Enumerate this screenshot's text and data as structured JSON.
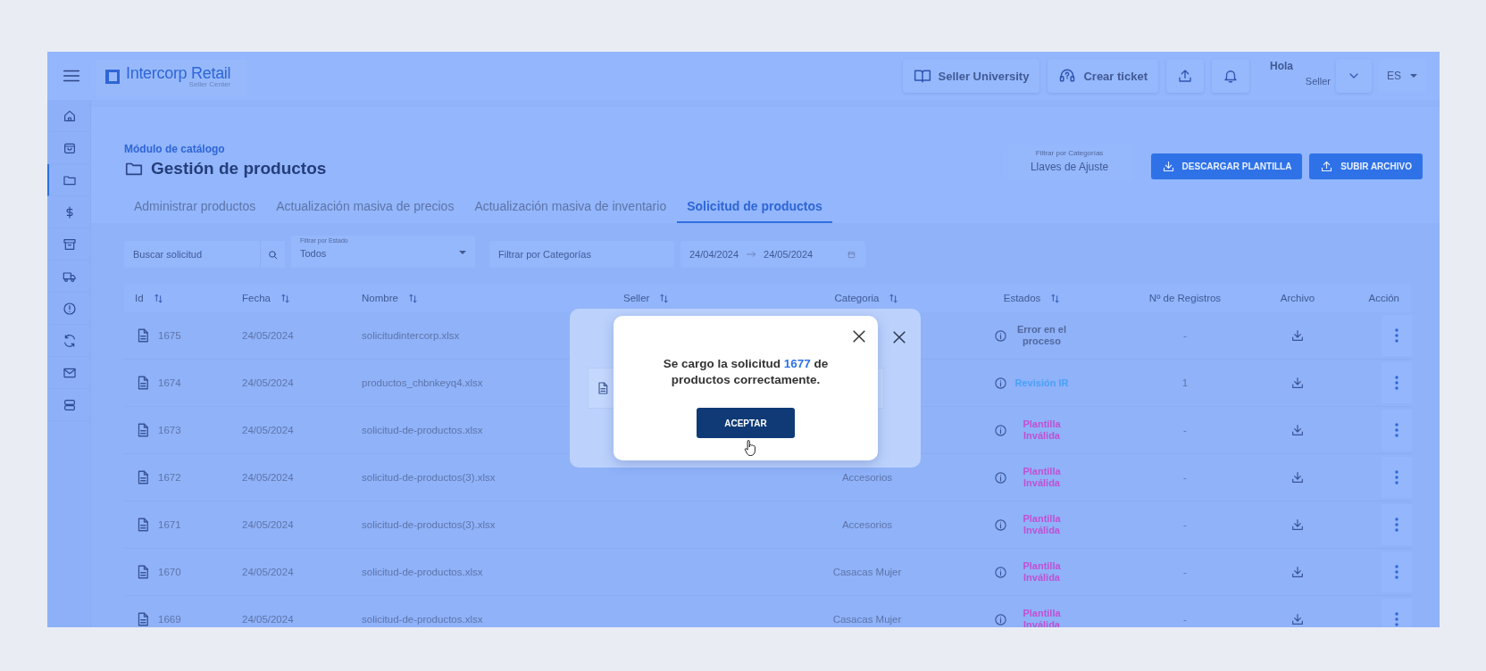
{
  "header": {
    "brand": "Intercorp Retail",
    "brand_subtitle": "Seller Center",
    "actions": [
      {
        "label": "Seller University",
        "kind": "book"
      },
      {
        "label": "Crear ticket",
        "kind": "support"
      }
    ],
    "greeting": "Hola",
    "user": "Seller",
    "language": "ES"
  },
  "sidebar": {
    "items": [
      {
        "selected": false
      },
      {
        "selected": false
      },
      {
        "selected": true
      },
      {
        "selected": false
      },
      {
        "selected": false
      },
      {
        "selected": false
      },
      {
        "selected": false
      },
      {
        "selected": false
      },
      {
        "selected": false
      },
      {
        "selected": false
      }
    ]
  },
  "page": {
    "breadcrumb": "Módulo de catálogo",
    "title": "Gestión de productos",
    "category_filter": {
      "label": "Filtrar por Categorías",
      "value": "Llaves de Ajuste"
    },
    "buttons": [
      {
        "label": "DESCARGAR PLANTILLA",
        "kind": "download"
      },
      {
        "label": "SUBIR ARCHIVO",
        "kind": "upload"
      }
    ]
  },
  "tabs": [
    {
      "label": "Administrar productos",
      "selected": false
    },
    {
      "label": "Actualización masiva de precios",
      "selected": false
    },
    {
      "label": "Actualización masiva de inventario",
      "selected": false
    },
    {
      "label": "Solicitud de productos",
      "selected": true
    }
  ],
  "filters": {
    "search": {
      "placeholder": "Buscar solicitud"
    },
    "state": {
      "label": "Filtrar por Estado",
      "value": "Todos"
    },
    "category": {
      "placeholder": "Filtrar por Categorías"
    },
    "date_from": "24/04/2024",
    "date_to": "24/05/2024"
  },
  "table": {
    "columns": [
      {
        "label": "Id",
        "sortable": true
      },
      {
        "label": "Fecha",
        "sortable": true
      },
      {
        "label": "Nombre",
        "sortable": true
      },
      {
        "label": "Seller",
        "sortable": true
      },
      {
        "label": "Categoria",
        "sortable": true
      },
      {
        "label": "Estados",
        "sortable": true
      },
      {
        "label": "Nº de Registros",
        "sortable": false
      },
      {
        "label": "Archivo",
        "sortable": false
      },
      {
        "label": "Acción",
        "sortable": false
      }
    ],
    "rows": [
      {
        "id": "1675",
        "date": "24/05/2024",
        "name": "solicitudintercorp.xlsx",
        "status": "Error en el proceso",
        "kind": "error",
        "records": "-"
      },
      {
        "id": "1674",
        "date": "24/05/2024",
        "name": "productos_chbnkeyq4.xlsx",
        "status": "Revisión IR",
        "kind": "review",
        "records": "1"
      },
      {
        "id": "1673",
        "date": "24/05/2024",
        "name": "solicitud-de-productos.xlsx",
        "status": "Plantilla Inválida",
        "kind": "invalid",
        "records": "-"
      },
      {
        "id": "1672",
        "date": "24/05/2024",
        "name": "solicitud-de-productos(3).xlsx",
        "category": "Accesorios",
        "status": "Plantilla Inválida",
        "kind": "invalid",
        "records": "-"
      },
      {
        "id": "1671",
        "date": "24/05/2024",
        "name": "solicitud-de-productos(3).xlsx",
        "category": "Accesorios",
        "status": "Plantilla Inválida",
        "kind": "invalid",
        "records": "-"
      },
      {
        "id": "1670",
        "date": "24/05/2024",
        "name": "solicitud-de-productos.xlsx",
        "category": "Casacas Mujer",
        "status": "Plantilla Inválida",
        "kind": "invalid",
        "records": "-"
      },
      {
        "id": "1669",
        "date": "24/05/2024",
        "name": "solicitud-de-productos.xlsx",
        "category": "Casacas Mujer",
        "status": "Plantilla Inválida",
        "kind": "invalid",
        "records": "-"
      }
    ]
  },
  "modal": {
    "message_start": "Se cargo la solicitud",
    "message_number": "1677",
    "message_end": "de productos correctamente.",
    "button": "ACEPTAR"
  }
}
